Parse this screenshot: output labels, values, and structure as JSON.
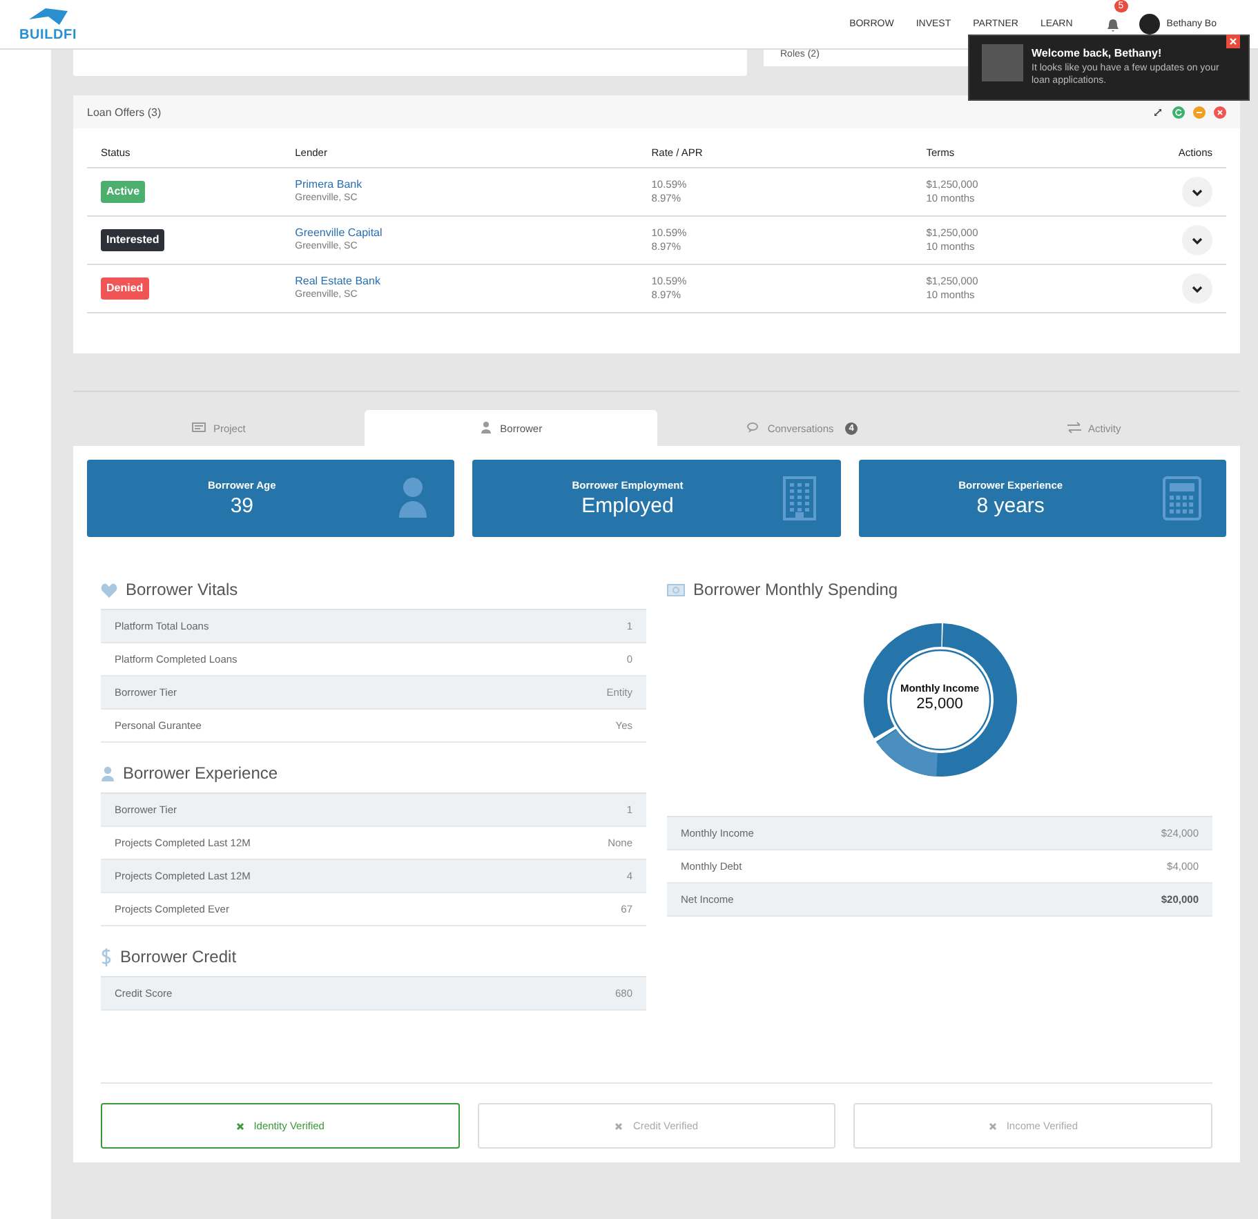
{
  "header": {
    "logo": "BUILDFI",
    "nav": [
      {
        "label": "BORROW"
      },
      {
        "label": "INVEST"
      },
      {
        "label": "PARTNER"
      },
      {
        "label": "LEARN"
      }
    ],
    "notification_count": "5",
    "user_name": "Bethany Bo"
  },
  "toast": {
    "title": "Welcome back, Bethany!",
    "message": "It looks like you have a few updates on your loan applications."
  },
  "top_cards": {
    "right_label": "Roles (2)"
  },
  "loan_offers": {
    "title": "Loan Offers (3)",
    "columns": [
      "Status",
      "Lender",
      "Rate / APR",
      "Terms",
      "Actions"
    ],
    "rows": [
      {
        "status": "Active",
        "color": "#4caf6e",
        "lender": "Primera Bank",
        "location": "Greenville, SC",
        "rate": "10.59%",
        "apr": "8.97%",
        "amount": "$1,250,000",
        "duration": "10 months"
      },
      {
        "status": "Interested",
        "color": "#2c3138",
        "lender": "Greenville Capital",
        "location": "Greenville, SC",
        "rate": "10.59%",
        "apr": "8.97%",
        "amount": "$1,250,000",
        "duration": "10 months"
      },
      {
        "status": "Denied",
        "color": "#f05454",
        "lender": "Real Estate Bank",
        "location": "Greenville, SC",
        "rate": "10.59%",
        "apr": "8.97%",
        "amount": "$1,250,000",
        "duration": "10 months"
      }
    ]
  },
  "tabs": [
    {
      "label": "Project",
      "selected": false
    },
    {
      "label": "Borrower",
      "selected": true
    },
    {
      "label": "Conversations",
      "selected": false,
      "badge": "4"
    },
    {
      "label": "Activity",
      "selected": false
    }
  ],
  "stats": [
    {
      "label": "Borrower Age",
      "value": "39"
    },
    {
      "label": "Borrower Employment",
      "value": "Employed"
    },
    {
      "label": "Borrower Experience",
      "value": "8 years"
    }
  ],
  "vitals": {
    "title": "Borrower Vitals",
    "rows": [
      {
        "label": "Platform Total Loans",
        "value": "1"
      },
      {
        "label": "Platform Completed Loans",
        "value": "0"
      },
      {
        "label": "Borrower Tier",
        "value": "Entity"
      },
      {
        "label": "Personal Gurantee",
        "value": "Yes"
      }
    ]
  },
  "experience": {
    "title": "Borrower Experience",
    "rows": [
      {
        "label": "Borrower Tier",
        "value": "1"
      },
      {
        "label": "Projects Completed Last 12M",
        "value": "None"
      },
      {
        "label": "Projects Completed Last 12M",
        "value": "4"
      },
      {
        "label": "Projects Completed Ever",
        "value": "67"
      }
    ]
  },
  "credit": {
    "title": "Borrower Credit",
    "rows": [
      {
        "label": "Credit Score",
        "value": "680"
      }
    ]
  },
  "spending": {
    "title": "Borrower Monthly Spending",
    "donut_label": "Monthly Income",
    "donut_value": "25,000",
    "rows": [
      {
        "label": "Monthly Income",
        "value": "$24,000",
        "bold": false
      },
      {
        "label": "Monthly Debt",
        "value": "$4,000",
        "bold": false
      },
      {
        "label": "Net Income",
        "value": "$20,000",
        "bold": true
      }
    ]
  },
  "verifications": [
    {
      "label": "Identity Verified",
      "verified": true
    },
    {
      "label": "Credit Verified",
      "verified": false
    },
    {
      "label": "Income Verified",
      "verified": false
    }
  ]
}
